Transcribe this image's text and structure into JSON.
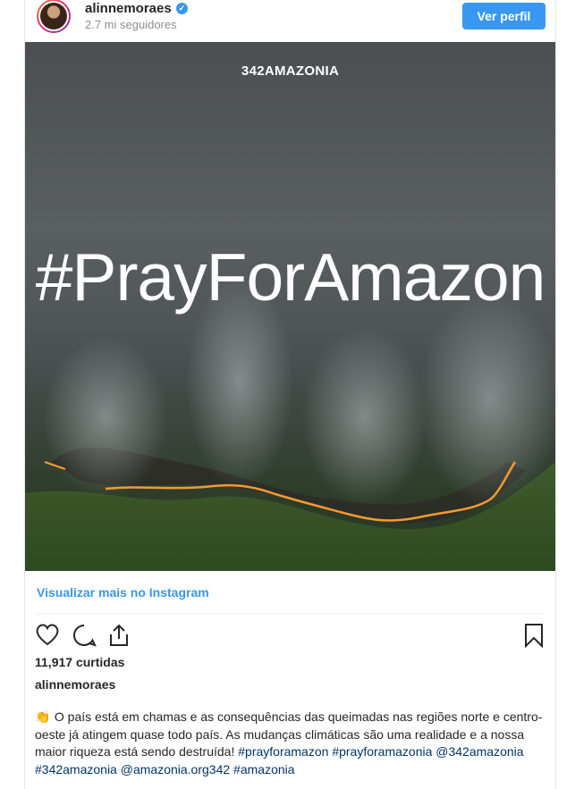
{
  "header": {
    "username": "alinnemoraes",
    "verified_symbol": "✓",
    "followers": "2.7 mi seguidores",
    "profile_button": "Ver perfil"
  },
  "photo": {
    "brand": "342AMAZONIA",
    "hashtag": "#PrayForAmazon"
  },
  "actions": {
    "more_link": "Visualizar mais no Instagram",
    "like_icon": "heart-icon",
    "comment_icon": "comment-icon",
    "share_icon": "share-icon",
    "save_icon": "bookmark-icon"
  },
  "post": {
    "likes": "11,917 curtidas",
    "author": "alinnemoraes",
    "caption_emoji": "👏",
    "caption_text": "O país está em chamas e as consequências das queimadas nas regiões norte e centro-oeste já atingem quase todo país. As mudanças climáticas são uma realidade e a nossa maior riqueza está sendo destruída!",
    "tags": [
      "#prayforamazon",
      "#prayforamazonia",
      "@342amazonia",
      "#342amazonia",
      "@amazonia.org342",
      "#amazonia"
    ]
  },
  "colors": {
    "accent": "#3897f0",
    "tag": "#003569"
  }
}
